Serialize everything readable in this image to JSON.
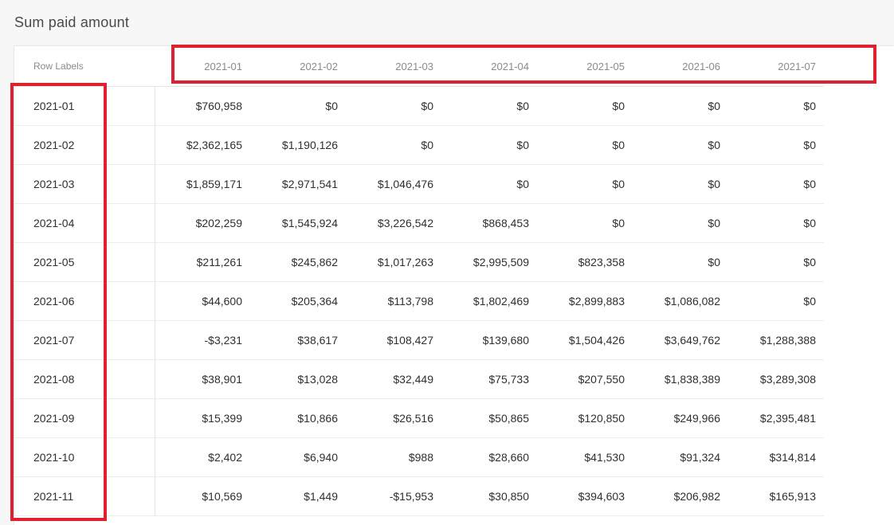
{
  "title": "Sum paid amount",
  "colors": {
    "highlight": "#e0202e",
    "background": "#f7f7f7",
    "card": "#ffffff"
  },
  "table": {
    "row_label_header": "Row Labels",
    "columns": [
      "2021-01",
      "2021-02",
      "2021-03",
      "2021-04",
      "2021-05",
      "2021-06",
      "2021-07"
    ],
    "rows": [
      {
        "label": "2021-01",
        "values": [
          "$760,958",
          "$0",
          "$0",
          "$0",
          "$0",
          "$0",
          "$0"
        ]
      },
      {
        "label": "2021-02",
        "values": [
          "$2,362,165",
          "$1,190,126",
          "$0",
          "$0",
          "$0",
          "$0",
          "$0"
        ]
      },
      {
        "label": "2021-03",
        "values": [
          "$1,859,171",
          "$2,971,541",
          "$1,046,476",
          "$0",
          "$0",
          "$0",
          "$0"
        ]
      },
      {
        "label": "2021-04",
        "values": [
          "$202,259",
          "$1,545,924",
          "$3,226,542",
          "$868,453",
          "$0",
          "$0",
          "$0"
        ]
      },
      {
        "label": "2021-05",
        "values": [
          "$211,261",
          "$245,862",
          "$1,017,263",
          "$2,995,509",
          "$823,358",
          "$0",
          "$0"
        ]
      },
      {
        "label": "2021-06",
        "values": [
          "$44,600",
          "$205,364",
          "$113,798",
          "$1,802,469",
          "$2,899,883",
          "$1,086,082",
          "$0"
        ]
      },
      {
        "label": "2021-07",
        "values": [
          "-$3,231",
          "$38,617",
          "$108,427",
          "$139,680",
          "$1,504,426",
          "$3,649,762",
          "$1,288,388"
        ]
      },
      {
        "label": "2021-08",
        "values": [
          "$38,901",
          "$13,028",
          "$32,449",
          "$75,733",
          "$207,550",
          "$1,838,389",
          "$3,289,308"
        ]
      },
      {
        "label": "2021-09",
        "values": [
          "$15,399",
          "$10,866",
          "$26,516",
          "$50,865",
          "$120,850",
          "$249,966",
          "$2,395,481"
        ]
      },
      {
        "label": "2021-10",
        "values": [
          "$2,402",
          "$6,940",
          "$988",
          "$28,660",
          "$41,530",
          "$91,324",
          "$314,814"
        ]
      },
      {
        "label": "2021-11",
        "values": [
          "$10,569",
          "$1,449",
          "-$15,953",
          "$30,850",
          "$394,603",
          "$206,982",
          "$165,913"
        ]
      }
    ]
  }
}
